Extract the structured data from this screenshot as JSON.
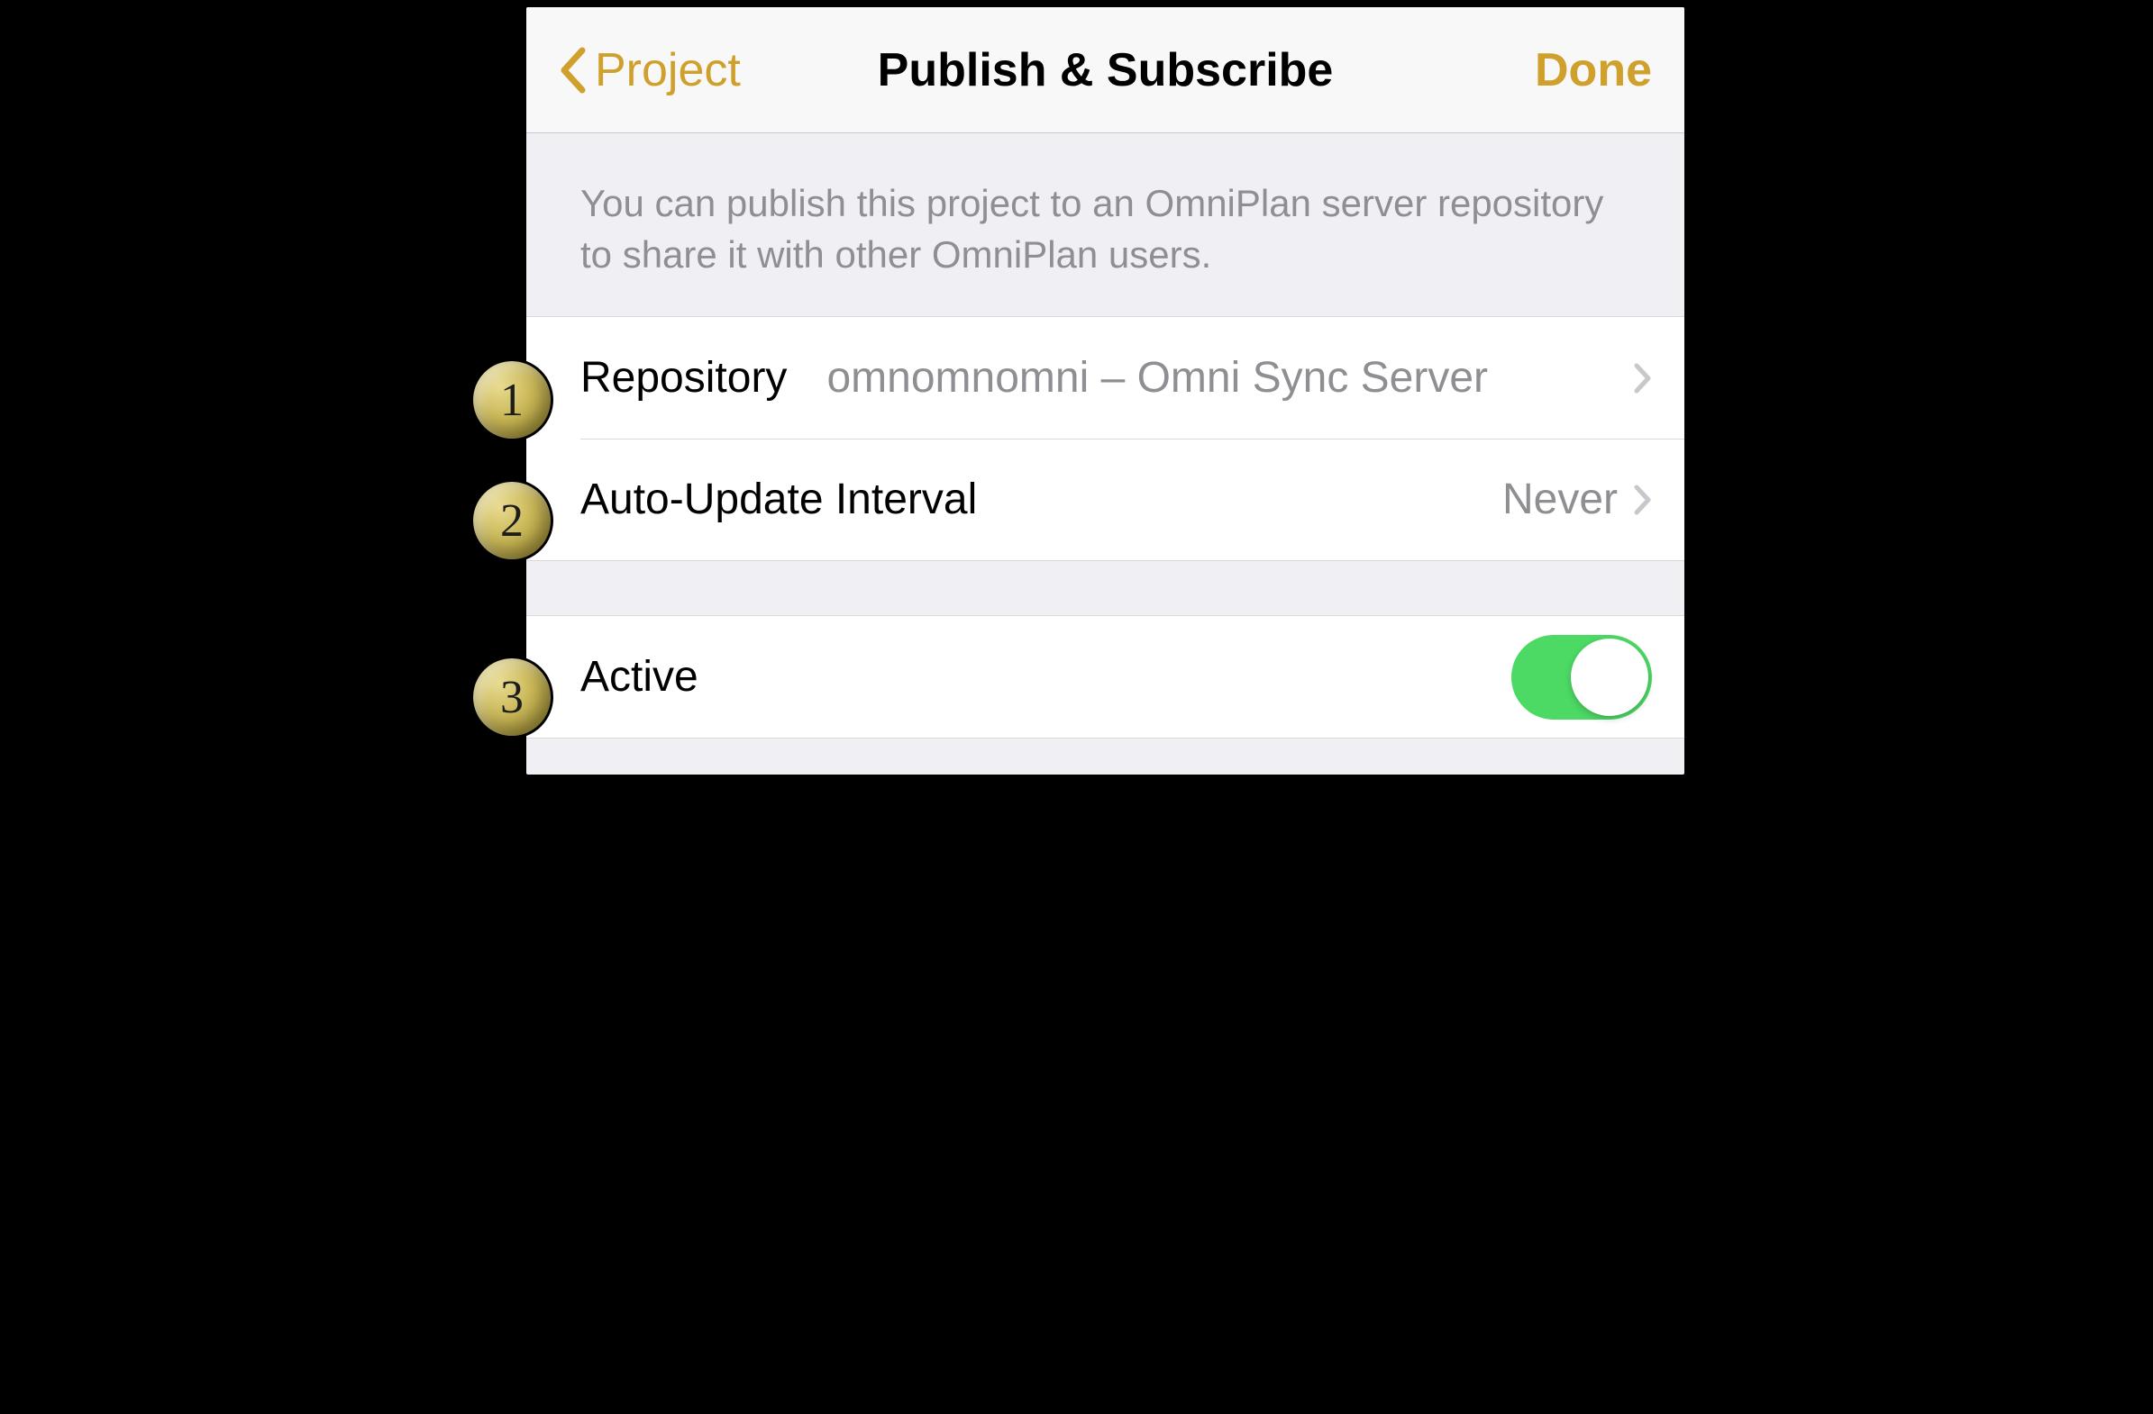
{
  "nav": {
    "back_label": "Project",
    "title": "Publish & Subscribe",
    "done_label": "Done"
  },
  "section_header": "You can publish this project to an OmniPlan server repository to share it with other OmniPlan users.",
  "rows": {
    "repository": {
      "label": "Repository",
      "value": "omnomnomni – Omni Sync Server"
    },
    "auto_update": {
      "label": "Auto-Update Interval",
      "value": "Never"
    },
    "active": {
      "label": "Active",
      "on": true
    }
  },
  "badges": [
    "1",
    "2",
    "3"
  ]
}
